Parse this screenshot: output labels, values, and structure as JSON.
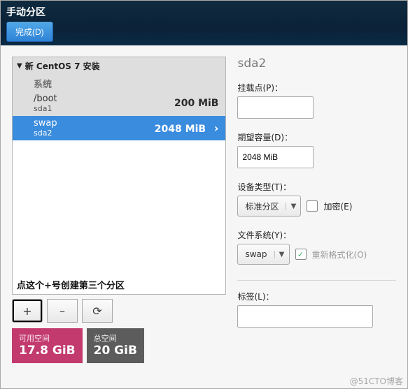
{
  "header": {
    "title": "手动分区",
    "done_label": "完成(D)"
  },
  "tree": {
    "heading": "新 CentOS 7 安装",
    "group_label": "系统",
    "rows": [
      {
        "mount": "/boot",
        "dev": "sda1",
        "size": "200 MiB"
      },
      {
        "mount": "swap",
        "dev": "sda2",
        "size": "2048 MiB"
      }
    ],
    "annotation": "点这个+号创建第三个分区"
  },
  "toolbar": {
    "add_label": "+",
    "remove_label": "–",
    "refresh_label": "⟳"
  },
  "space": {
    "avail_label": "可用空间",
    "avail_value": "17.8 GiB",
    "total_label": "总空间",
    "total_value": "20 GiB"
  },
  "form": {
    "device_title": "sda2",
    "mount_label": "挂载点(P)：",
    "mount_value": "",
    "capacity_label": "期望容量(D)：",
    "capacity_value": "2048 MiB",
    "devtype_label": "设备类型(T)：",
    "devtype_value": "标准分区",
    "encrypt_label": "加密(E)",
    "fs_label": "文件系统(Y)：",
    "fs_value": "swap",
    "reformat_label": "重新格式化(O)",
    "tag_label": "标签(L)：",
    "tag_value": ""
  },
  "footer": "@51CTO博客"
}
